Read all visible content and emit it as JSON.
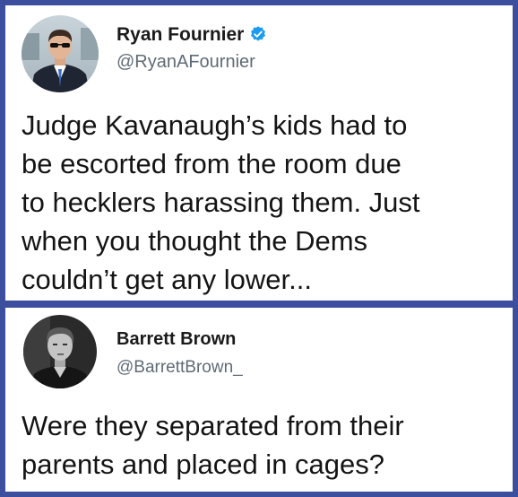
{
  "tweets": [
    {
      "author_name": "Ryan Fournier",
      "handle": "@RyanAFournier",
      "verified": true,
      "avatar_icon": "profile-photo-man-suit-sunglasses",
      "text_lines": [
        "Judge Kavanaugh’s kids had to",
        "be escorted from the room due",
        "to hecklers harassing them. Just",
        "when you thought the Dems",
        "couldn’t get any lower..."
      ]
    },
    {
      "author_name": "Barrett Brown",
      "handle": "@BarrettBrown_",
      "verified": false,
      "avatar_icon": "profile-photo-man-bw",
      "text_lines": [
        "Were they separated from their",
        "parents and placed in cages?"
      ]
    }
  ],
  "colors": {
    "background_border": "#3b4f9e",
    "verified_badge": "#1d9bf0"
  }
}
